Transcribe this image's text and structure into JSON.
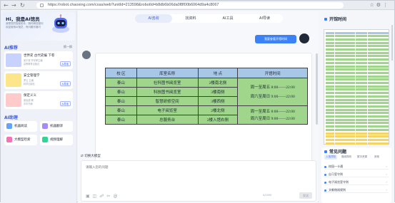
{
  "browser": {
    "url": "https://robot.chaoxing.com/cxas/web?unitId=213598&robotId=b8db6b06da0f8f00b6064d9a4c8067"
  },
  "sidebar": {
    "greeting": "Hi，我是AI馆员",
    "subtitle_1": "我是您的智能助手，随时解答疑问",
    "subtitle_2": "欢迎使用AI馆员，有问题尽管问",
    "recommend_title": "AI推荐",
    "more_label": "换一换",
    "recommend_items": [
      {
        "name": "世界史 古代史编 下卷",
        "desc": "吴于廑 齐世荣主编",
        "desc2": "高等教育出版社",
        "btn": "AI导读",
        "color": "#c7d2fe"
      },
      {
        "name": "安全管理学",
        "desc": "罗云 主编",
        "desc2": "科学出版社",
        "btn": "AI导读",
        "color": "#fde68a"
      },
      {
        "name": "保定义义",
        "desc": "梁启超 著",
        "desc2": "中华书局",
        "btn": "AI导读",
        "color": "#fecaca"
      }
    ],
    "tools_title": "AI助理",
    "tools": [
      {
        "label": "机器阅读",
        "color": "#60a5fa"
      },
      {
        "label": "机器翻译",
        "color": "#a78bfa"
      },
      {
        "label": "大模型检索",
        "color": "#f472b6"
      },
      {
        "label": "视频理解",
        "color": "#34d399"
      }
    ]
  },
  "main": {
    "tabs": [
      {
        "label": "AI咨询",
        "active": true
      },
      {
        "label": "找资料",
        "active": false
      },
      {
        "label": "AI工具",
        "active": false
      },
      {
        "label": "AI导读",
        "active": false
      }
    ],
    "user_message": "我要查看开馆时间",
    "table": {
      "headers": [
        "校 区",
        "库室名称",
        "地  点",
        "开馆时间"
      ],
      "rows": [
        {
          "campus": "泰山",
          "room": "社科图书阅览室",
          "place": "2楼南北侧"
        },
        {
          "campus": "泰山",
          "room": "科技图书阅览室",
          "place": "3楼南侧"
        },
        {
          "campus": "泰山",
          "room": "智慧研修空间",
          "place": "3楼西侧"
        },
        {
          "campus": "泰山",
          "room": "电子阅览室",
          "place": "2楼北侧"
        },
        {
          "campus": "泰山",
          "room": "总服务台",
          "place": "2楼入馆右侧"
        }
      ],
      "hours_group_1": [
        "周一至周五 8:00——22:00",
        "周六至周日 9:00——22:00"
      ],
      "hours_group_2": [
        "周一至周五 8:00——22:00",
        "周六至周日 9:00——22:00"
      ]
    },
    "switch_model": "切换大模型",
    "input_placeholder": "请输入您的问题",
    "counter": "0/1000",
    "send_label": "发送"
  },
  "right_panel": {
    "hours_title": "开馆时间",
    "faq_title": "常见问题",
    "faq_tabs": [
      {
        "label": "入馆须知",
        "active": true
      },
      {
        "label": "借阅规则",
        "active": false
      },
      {
        "label": "数字资源",
        "active": false
      },
      {
        "label": "其他",
        "active": false
      }
    ],
    "faq_items": [
      "校园一卡通",
      "自习室守则",
      "电子阅览室守则",
      "文献借阅规则"
    ]
  },
  "colors": {
    "accent": "#3b5bdb",
    "table_header": "#a8c6e6",
    "table_body": "#9fd68c",
    "user_bubble": "#3b82f6"
  }
}
